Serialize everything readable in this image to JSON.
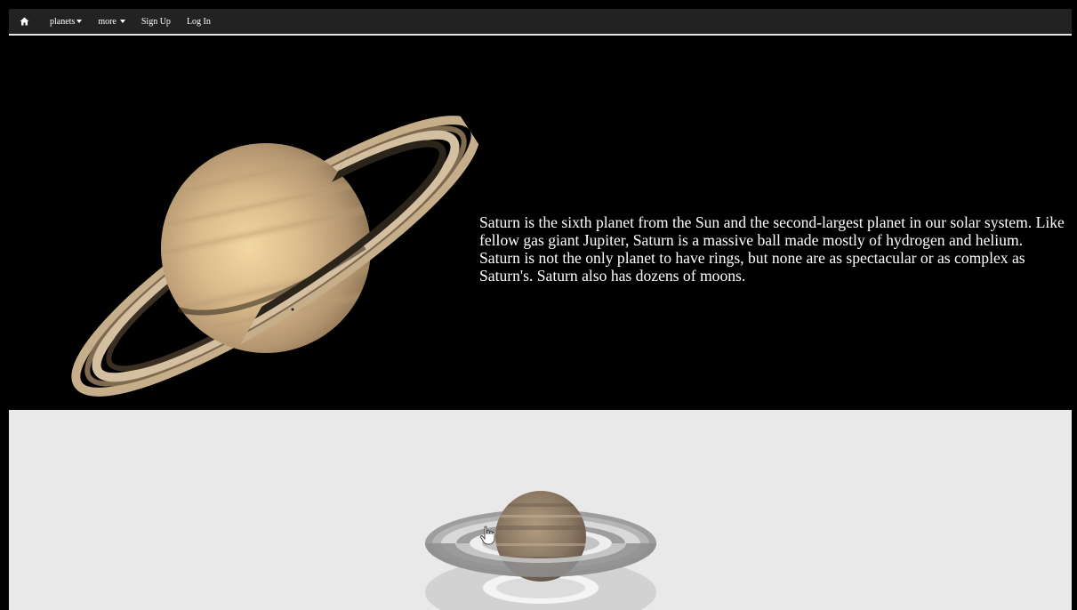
{
  "nav": {
    "home_icon": "home-icon",
    "items": [
      {
        "label": "planets",
        "has_caret": true
      },
      {
        "label": "more",
        "has_caret": true
      },
      {
        "label": "Sign Up",
        "has_caret": false
      },
      {
        "label": "Log In",
        "has_caret": false
      }
    ]
  },
  "hero": {
    "description": "Saturn is the sixth planet from the Sun and the second-largest planet in our solar system. Like fellow gas giant Jupiter, Saturn is a massive ball made mostly of hydrogen and helium. Saturn is not the only planet to have rings, but none are as spectacular or as complex as Saturn's. Saturn also has dozens of moons."
  },
  "viewer": {
    "cursor_icon": "hand-pointer-icon"
  },
  "colors": {
    "navbar_bg": "#222222",
    "hero_bg": "#000000",
    "viewer_bg": "#e9e9e9"
  }
}
